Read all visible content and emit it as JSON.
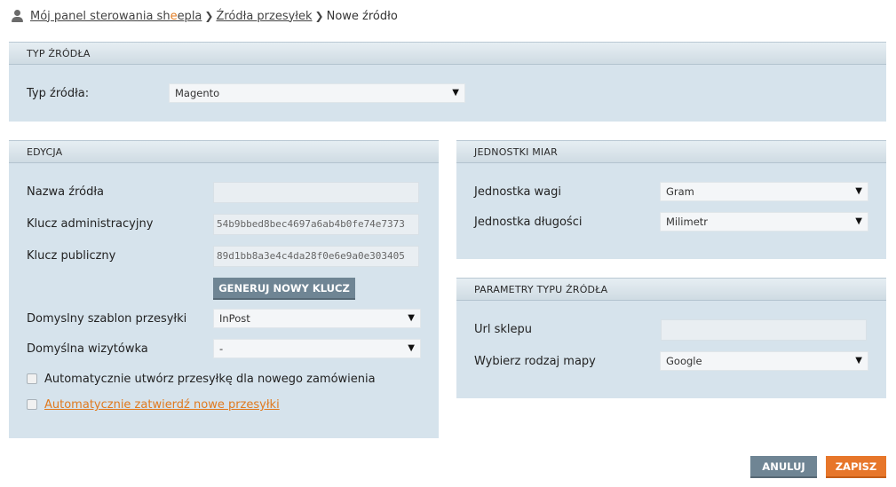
{
  "breadcrumb": {
    "item1_prefix": "Mój panel sterowania sh",
    "item1_highlight": "e",
    "item1_suffix": "epla",
    "item2": "Źródła przesyłek",
    "item3": "Nowe źródło"
  },
  "typ_zrodla": {
    "header": "TYP ŹRÓDŁA",
    "label": "Typ źródła:",
    "value": "Magento"
  },
  "edycja": {
    "header": "EDYCJA",
    "nazwa_label": "Nazwa źródła",
    "nazwa_value": "",
    "klucz_admin_label": "Klucz administracyjny",
    "klucz_admin_value": "54b9bbed8bec4697a6ab4b0fe74e7373",
    "klucz_pub_label": "Klucz publiczny",
    "klucz_pub_value": "89d1bb8a3e4c4da28f0e6e9a0e303405",
    "generate_button": "GENERUJ NOWY KLUCZ",
    "szablon_label": "Domyslny szablon przesyłki",
    "szablon_value": "InPost",
    "wizytowka_label": "Domyślna wizytówka",
    "wizytowka_value": "-",
    "auto_create_label": "Automatycznie utwórz przesyłkę dla nowego zamówienia",
    "auto_confirm_label": "Automatycznie zatwierdź nowe przesyłki"
  },
  "jednostki": {
    "header": "JEDNOSTKI MIAR",
    "waga_label": "Jednostka wagi",
    "waga_value": "Gram",
    "dlugosc_label": "Jednostka długości",
    "dlugosc_value": "Milimetr"
  },
  "parametry": {
    "header": "PARAMETRY TYPU ŹRÓDŁA",
    "url_label": "Url sklepu",
    "url_value": "",
    "mapa_label": "Wybierz rodzaj mapy",
    "mapa_value": "Google"
  },
  "actions": {
    "cancel": "ANULUJ",
    "save": "ZAPISZ"
  },
  "icons": {
    "user": "user-icon",
    "separator": "chevron-right-icon",
    "dropdown": "triangle-down-icon"
  },
  "colors": {
    "panel_bg": "#d6e3ec",
    "button_gray": "#6f8594",
    "button_orange": "#e7762a",
    "link_orange": "#e07a1f"
  }
}
